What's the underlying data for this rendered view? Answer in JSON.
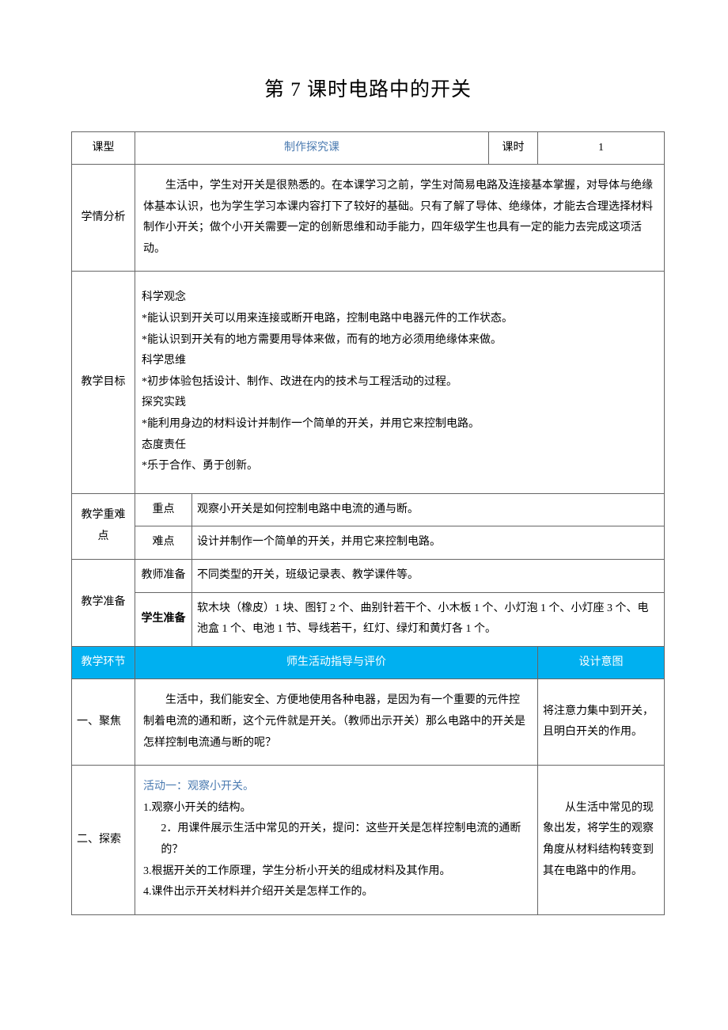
{
  "title": "第 7 课时电路中的开关",
  "row_type": {
    "label": "课型",
    "value": "制作探究课",
    "period_label": "课时",
    "period_value": "1"
  },
  "analysis": {
    "label": "学情分析",
    "text": "生活中，学生对开关是很熟悉的。在本课学习之前，学生对简易电路及连接基本掌握，对导体与绝缘体基本认识，也为学生学习本课内容打下了较好的基础。只有了解了导体、绝缘体，才能去合理选择材料制作小开关；做个小开关需要一定的创新思维和动手能力，四年级学生也具有一定的能力去完成这项活动。"
  },
  "goals": {
    "label": "教学目标",
    "h1": "科学观念",
    "g1": "*能认识到开关可以用来连接或断开电路，控制电路中电器元件的工作状态。",
    "g2": "*能认识到开关有的地方需要用导体来做，而有的地方必须用绝缘体来做。",
    "h2": "科学思维",
    "g3": "*初步体验包括设计、制作、改进在内的技术与工程活动的过程。",
    "h3": "探究实践",
    "g4": "*能利用身边的材料设计并制作一个简单的开关，并用它来控制电路。",
    "h4": "态度责任",
    "g5": "*乐于合作、勇于创新。"
  },
  "keypoints": {
    "label": "教学重难点",
    "r1_label": "重点",
    "r1_text": "观察小开关是如何控制电路中电流的通与断。",
    "r2_label": "难点",
    "r2_text": "设计并制作一个简单的开关，并用它来控制电路。"
  },
  "prep": {
    "label": "教学准备",
    "r1_label": "教师准备",
    "r1_text": "不同类型的开关，班级记录表、教学课件等。",
    "r2_label": "学生准备",
    "r2_text": "软木块（橡皮）1 块、图钉 2 个、曲别针若干个、小木板 1 个、小灯泡 1 个、小灯座 3 个、电池盒 1 个、电池 1 节、导线若干，红灯、绿灯和黄灯各 1 个。"
  },
  "header": {
    "c1": "教学环节",
    "c2": "师生活动指导与评价",
    "c3": "设计意图"
  },
  "sec1": {
    "label": "一、聚焦",
    "text": "生活中，我们能安全、方便地使用各种电器，是因为有一个重要的元件控制着电流的通和断，这个元件就是开关。（教师出示开关）那么电路中的开关是怎样控制电流通与断的呢？",
    "intent": "将注意力集中到开关，且明白开关的作用。"
  },
  "sec2": {
    "label": "二、探索",
    "title": "活动一：观察小开关。",
    "l1": "1.观察小开关的结构。",
    "l2a": "2",
    "l2b": "．用课件展示生活中常见的开关，提问：这些开关是怎样控制电流的通断的？",
    "l3": "3.根据开关的工作原理，学生分析小开关的组成材料及其作用。",
    "l4": "4.课件出示开关材料并介绍开关是怎样工作的。",
    "intent": "从生活中常见的现象出发，将学生的观察角度从材料结构转变到其在电路中的作用。"
  }
}
